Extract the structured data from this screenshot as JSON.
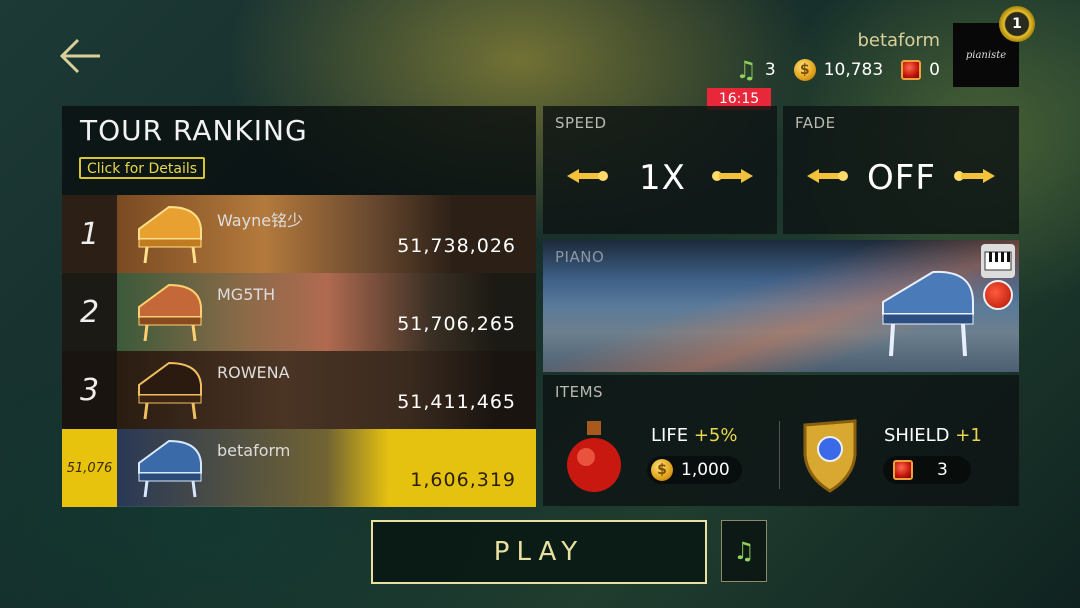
{
  "header": {
    "username": "betaform",
    "notes_count": "3",
    "coins": "10,783",
    "gems": "0",
    "timer": "16:15",
    "level": "1",
    "avatar_text": "pianiste"
  },
  "ranking": {
    "title": "TOUR RANKING",
    "details_label": "Click for Details",
    "rows": [
      {
        "rank": "1",
        "name": "Wayne铭少",
        "score": "51,738,026"
      },
      {
        "rank": "2",
        "name": "MG5TH",
        "score": "51,706,265"
      },
      {
        "rank": "3",
        "name": "ROWENA",
        "score": "51,411,465"
      }
    ],
    "me": {
      "rank": "51,076",
      "name": "betaform",
      "score": "1,606,319"
    }
  },
  "speed": {
    "label": "SPEED",
    "value": "1X"
  },
  "fade": {
    "label": "FADE",
    "value": "OFF"
  },
  "piano": {
    "label": "PIANO"
  },
  "items": {
    "label": "ITEMS",
    "life": {
      "name": "LIFE",
      "bonus": "+5%",
      "cost": "1,000"
    },
    "shield": {
      "name": "SHIELD",
      "bonus": "+1",
      "cost": "3"
    }
  },
  "play_label": "PLAY",
  "colors": {
    "accent": "#e8c30e",
    "timer": "#e8283a",
    "note": "#8fd35a",
    "bonus": "#e8d650"
  }
}
